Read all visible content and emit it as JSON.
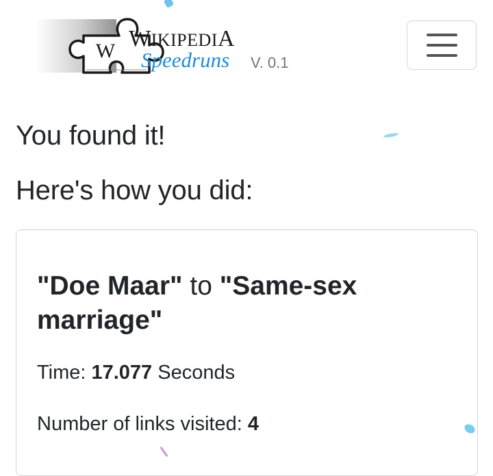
{
  "header": {
    "logo": {
      "puzzle_letter": "W",
      "wiki_first": "W",
      "wiki_mid": "IKIPEDI",
      "wiki_last": "A",
      "subtitle": "Speedruns"
    },
    "version": "V. 0.1",
    "menu_icon": "hamburger-menu-icon"
  },
  "main": {
    "found_heading": "You found it!",
    "results_heading": "Here's how you did:",
    "result": {
      "start_article": "\"Doe Maar\"",
      "connector": " to ",
      "end_article": "\"Same-sex marriage\"",
      "time_label": "Time: ",
      "time_value": "17.077",
      "time_unit": " Seconds",
      "links_label": "Number of links visited: ",
      "links_value": "4"
    }
  },
  "colors": {
    "speedruns_blue": "#1f8dd6",
    "text": "#212529",
    "muted": "#6c757d",
    "border": "#d4d4d4"
  }
}
